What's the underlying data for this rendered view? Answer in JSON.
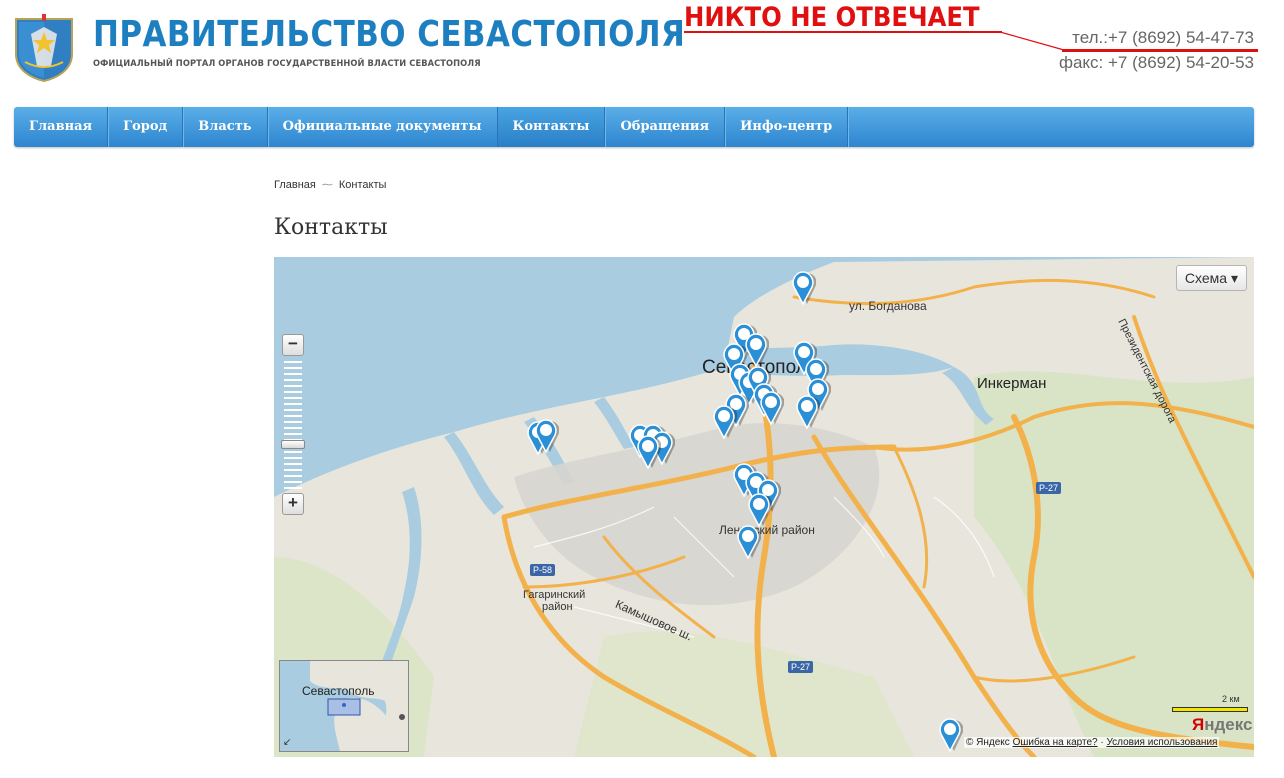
{
  "header": {
    "title": "ПРАВИТЕЛЬСТВО СЕВАСТОПОЛЯ",
    "subtitle": "ОФИЦИАЛЬНЫЙ ПОРТАЛ ОРГАНОВ ГОСУДАРСТВЕННОЙ ВЛАСТИ СЕВАСТОПОЛЯ",
    "phone": "тел.:+7 (8692) 54-47-73",
    "fax": "факс: +7 (8692) 54-20-53",
    "annotation": "НИКТО НЕ ОТВЕЧАЕТ"
  },
  "nav": {
    "items": [
      "Главная",
      "Город",
      "Власть",
      "Официальные документы",
      "Контакты",
      "Обращения",
      "Инфо-центр"
    ],
    "active": "Контакты"
  },
  "breadcrumb": {
    "home": "Главная",
    "current": "Контакты"
  },
  "page": {
    "title": "Контакты"
  },
  "map": {
    "scheme_label": "Схема ▾",
    "zoom_in": "+",
    "zoom_out": "−",
    "labels": {
      "city": "Севастополь",
      "inkerman": "Инкерман",
      "bogdanova": "ул. Богданова",
      "presidential_road": "Президентская дорога",
      "leninsky": "Ленинский район",
      "gagarinsky_1": "Гагаринский",
      "gagarinsky_2": "район",
      "kamyshovoe": "Камышовое ш.",
      "r58": "P-58",
      "r27a": "P-27",
      "r27b": "P-27"
    },
    "minimap_label": "Севастополь",
    "scale_label": "2 км",
    "logo": "Яндекс",
    "copyright": "© Яндекс",
    "error_link": "Ошибка на карте?",
    "terms_link": "Условия использования"
  },
  "colors": {
    "brand_blue": "#1e7fc0",
    "nav_top": "#5aaee8",
    "nav_bottom": "#2f86cf",
    "annotation_red": "#e01010",
    "water": "#a9cce0",
    "land": "#e8e6dc",
    "road": "#f2b14a",
    "marker": "#2a8fd6"
  }
}
